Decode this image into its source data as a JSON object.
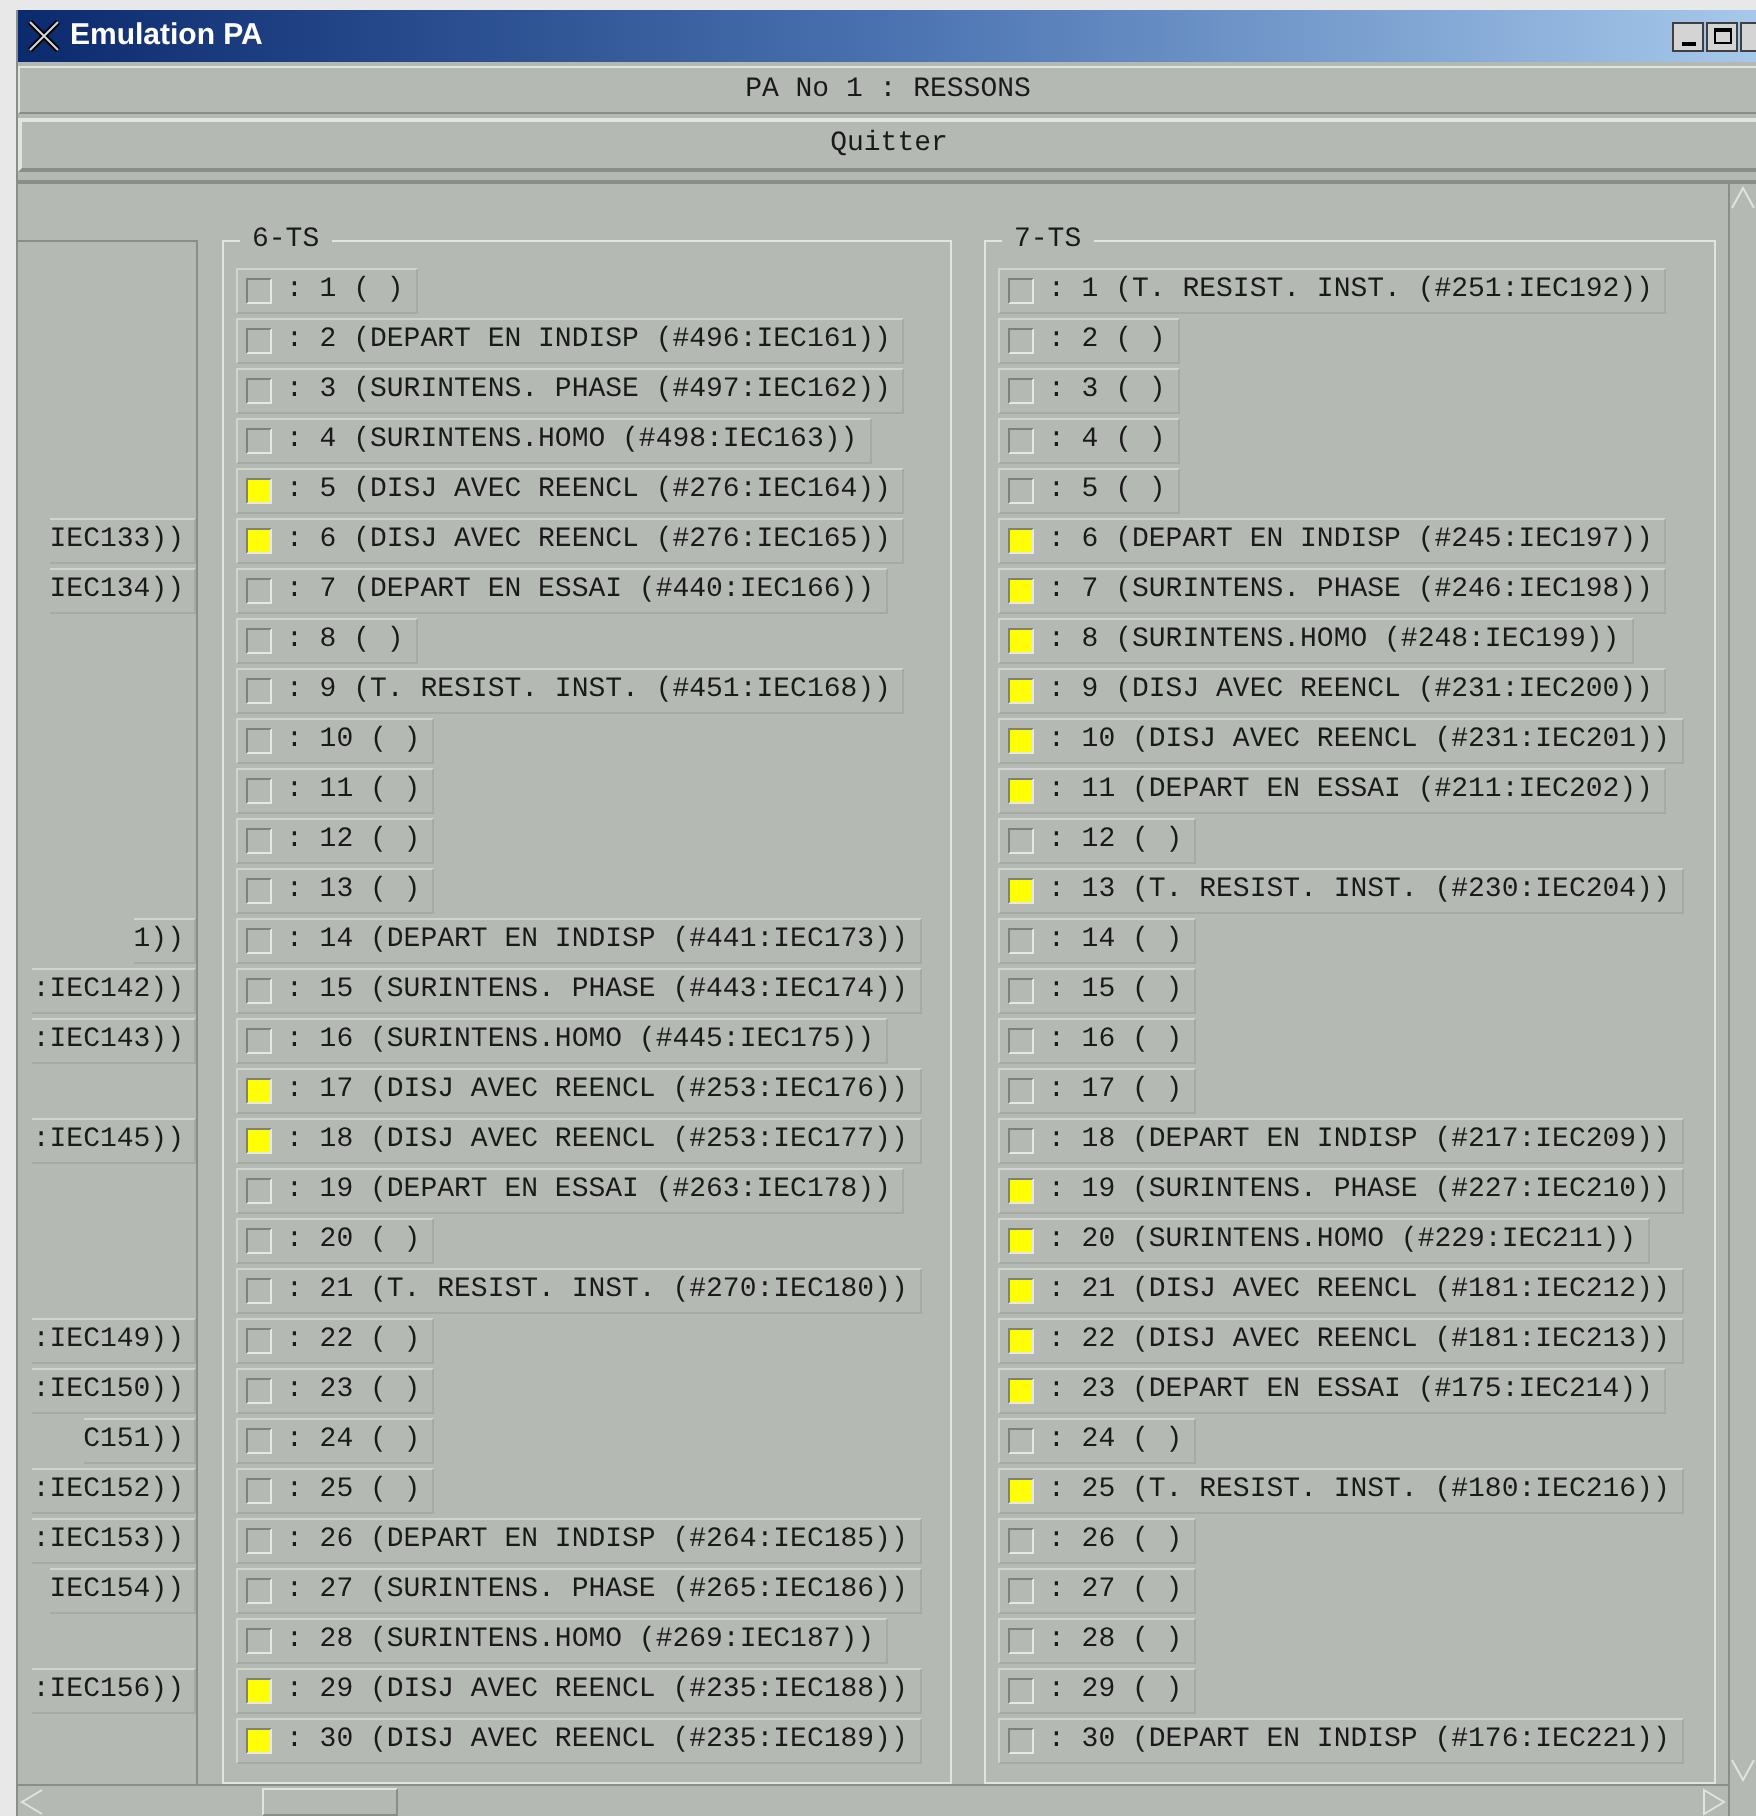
{
  "window": {
    "title": "Emulation PA"
  },
  "header": "PA No 1 : RESSONS",
  "quit_button": "Quitter",
  "left_column": {
    "rows": [
      {
        "kind": "blank"
      },
      {
        "kind": "blank"
      },
      {
        "kind": "blank"
      },
      {
        "kind": "blank"
      },
      {
        "kind": "blank"
      },
      {
        "kind": "text",
        "text": "IEC133))"
      },
      {
        "kind": "text",
        "text": "IEC134))"
      },
      {
        "kind": "blank"
      },
      {
        "kind": "blank"
      },
      {
        "kind": "blank"
      },
      {
        "kind": "blank"
      },
      {
        "kind": "blank"
      },
      {
        "kind": "blank"
      },
      {
        "kind": "text",
        "text": "1))"
      },
      {
        "kind": "text",
        "text": ":IEC142))"
      },
      {
        "kind": "text",
        "text": ":IEC143))"
      },
      {
        "kind": "blank"
      },
      {
        "kind": "text",
        "text": ":IEC145))"
      },
      {
        "kind": "blank"
      },
      {
        "kind": "blank"
      },
      {
        "kind": "blank"
      },
      {
        "kind": "text",
        "text": ":IEC149))"
      },
      {
        "kind": "text",
        "text": ":IEC150))"
      },
      {
        "kind": "text",
        "text": "C151))"
      },
      {
        "kind": "text",
        "text": ":IEC152))"
      },
      {
        "kind": "text",
        "text": ":IEC153))"
      },
      {
        "kind": "text",
        "text": "IEC154))"
      },
      {
        "kind": "blank"
      },
      {
        "kind": "text",
        "text": ":IEC156))"
      },
      {
        "kind": "blank"
      }
    ]
  },
  "groups": [
    {
      "title": "6-TS",
      "rows": [
        {
          "label": ": 1 ( )",
          "checked": false
        },
        {
          "label": ": 2 (DEPART EN INDISP (#496:IEC161))",
          "checked": false
        },
        {
          "label": ": 3 (SURINTENS. PHASE (#497:IEC162))",
          "checked": false
        },
        {
          "label": ": 4 (SURINTENS.HOMO (#498:IEC163))",
          "checked": false
        },
        {
          "label": ": 5 (DISJ AVEC REENCL (#276:IEC164))",
          "checked": true
        },
        {
          "label": ": 6 (DISJ AVEC REENCL (#276:IEC165))",
          "checked": true
        },
        {
          "label": ": 7 (DEPART EN ESSAI (#440:IEC166))",
          "checked": false
        },
        {
          "label": ": 8 ( )",
          "checked": false
        },
        {
          "label": ": 9 (T. RESIST. INST. (#451:IEC168))",
          "checked": false
        },
        {
          "label": ": 10 ( )",
          "checked": false
        },
        {
          "label": ": 11 ( )",
          "checked": false
        },
        {
          "label": ": 12 ( )",
          "checked": false
        },
        {
          "label": ": 13 ( )",
          "checked": false
        },
        {
          "label": ": 14 (DEPART EN INDISP (#441:IEC173))",
          "checked": false
        },
        {
          "label": ": 15 (SURINTENS. PHASE (#443:IEC174))",
          "checked": false
        },
        {
          "label": ": 16 (SURINTENS.HOMO (#445:IEC175))",
          "checked": false
        },
        {
          "label": ": 17 (DISJ AVEC REENCL (#253:IEC176))",
          "checked": true
        },
        {
          "label": ": 18 (DISJ AVEC REENCL (#253:IEC177))",
          "checked": true
        },
        {
          "label": ": 19 (DEPART EN ESSAI (#263:IEC178))",
          "checked": false
        },
        {
          "label": ": 20 ( )",
          "checked": false
        },
        {
          "label": ": 21 (T. RESIST. INST. (#270:IEC180))",
          "checked": false
        },
        {
          "label": ": 22 ( )",
          "checked": false
        },
        {
          "label": ": 23 ( )",
          "checked": false
        },
        {
          "label": ": 24 ( )",
          "checked": false
        },
        {
          "label": ": 25 ( )",
          "checked": false
        },
        {
          "label": ": 26 (DEPART EN INDISP (#264:IEC185))",
          "checked": false
        },
        {
          "label": ": 27 (SURINTENS. PHASE (#265:IEC186))",
          "checked": false
        },
        {
          "label": ": 28 (SURINTENS.HOMO (#269:IEC187))",
          "checked": false
        },
        {
          "label": ": 29 (DISJ AVEC REENCL (#235:IEC188))",
          "checked": true
        },
        {
          "label": ": 30 (DISJ AVEC REENCL (#235:IEC189))",
          "checked": true
        }
      ]
    },
    {
      "title": "7-TS",
      "rows": [
        {
          "label": ": 1 (T. RESIST. INST. (#251:IEC192))",
          "checked": false
        },
        {
          "label": ": 2 ( )",
          "checked": false
        },
        {
          "label": ": 3 ( )",
          "checked": false
        },
        {
          "label": ": 4 ( )",
          "checked": false
        },
        {
          "label": ": 5 ( )",
          "checked": false
        },
        {
          "label": ": 6 (DEPART EN INDISP (#245:IEC197))",
          "checked": true
        },
        {
          "label": ": 7 (SURINTENS. PHASE (#246:IEC198))",
          "checked": true
        },
        {
          "label": ": 8 (SURINTENS.HOMO (#248:IEC199))",
          "checked": true
        },
        {
          "label": ": 9 (DISJ AVEC REENCL (#231:IEC200))",
          "checked": true
        },
        {
          "label": ": 10 (DISJ AVEC REENCL (#231:IEC201))",
          "checked": true
        },
        {
          "label": ": 11 (DEPART EN ESSAI (#211:IEC202))",
          "checked": true
        },
        {
          "label": ": 12 ( )",
          "checked": false
        },
        {
          "label": ": 13 (T. RESIST. INST. (#230:IEC204))",
          "checked": true
        },
        {
          "label": ": 14 ( )",
          "checked": false
        },
        {
          "label": ": 15 ( )",
          "checked": false
        },
        {
          "label": ": 16 ( )",
          "checked": false
        },
        {
          "label": ": 17 ( )",
          "checked": false
        },
        {
          "label": ": 18 (DEPART EN INDISP (#217:IEC209))",
          "checked": false
        },
        {
          "label": ": 19 (SURINTENS. PHASE (#227:IEC210))",
          "checked": true
        },
        {
          "label": ": 20 (SURINTENS.HOMO (#229:IEC211))",
          "checked": true
        },
        {
          "label": ": 21 (DISJ AVEC REENCL (#181:IEC212))",
          "checked": true
        },
        {
          "label": ": 22 (DISJ AVEC REENCL (#181:IEC213))",
          "checked": true
        },
        {
          "label": ": 23 (DEPART EN ESSAI (#175:IEC214))",
          "checked": true
        },
        {
          "label": ": 24 ( )",
          "checked": false
        },
        {
          "label": ": 25 (T. RESIST. INST. (#180:IEC216))",
          "checked": true
        },
        {
          "label": ": 26 ( )",
          "checked": false
        },
        {
          "label": ": 27 ( )",
          "checked": false
        },
        {
          "label": ": 28 ( )",
          "checked": false
        },
        {
          "label": ": 29 ( )",
          "checked": false
        },
        {
          "label": ": 30 (DEPART EN INDISP (#176:IEC221))",
          "checked": false
        }
      ]
    }
  ]
}
